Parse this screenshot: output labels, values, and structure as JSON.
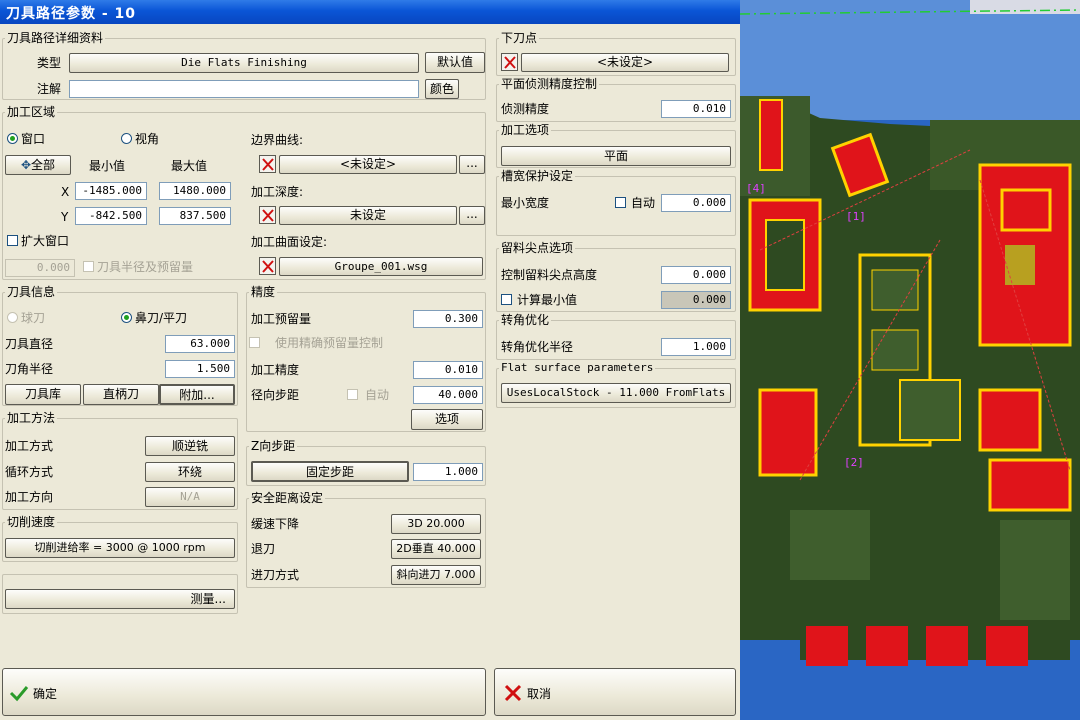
{
  "title": "刀具路径参数 - 10",
  "details": {
    "group_title": "刀具路径详细资料",
    "type_label": "类型",
    "type_value": "Die Flats Finishing",
    "defaults_button": "默认值",
    "note_label": "注解",
    "note_value": "",
    "color_button": "颜色"
  },
  "machining_area": {
    "group_title": "加工区域",
    "window_label": "窗口",
    "view_label": "视角",
    "all_button": "全部",
    "min_header": "最小值",
    "max_header": "最大值",
    "x_label": "X",
    "y_label": "Y",
    "x_min": "-1485.000",
    "x_max": "1480.000",
    "y_min": "-842.500",
    "y_max": "837.500",
    "enlarge_label": "扩大窗口",
    "enlarge_value": "0.000",
    "radius_stock_label": "刀具半径及预留量",
    "boundary_label": "边界曲线:",
    "boundary_value": "<未设定>",
    "depth_label": "加工深度:",
    "depth_value": "未设定",
    "surface_label": "加工曲面设定:",
    "surface_value": "Groupe_001.wsg",
    "ellipsis": "..."
  },
  "tool_info": {
    "group_title": "刀具信息",
    "ball_label": "球刀",
    "nose_label": "鼻刀/平刀",
    "diameter_label": "刀具直径",
    "diameter_value": "63.000",
    "corner_label": "刀角半径",
    "corner_value": "1.500",
    "library_button": "刀具库",
    "holder_button": "直柄刀",
    "extra_button": "附加..."
  },
  "precision": {
    "group_title": "精度",
    "stock_label": "加工预留量",
    "stock_value": "0.300",
    "exact_stock_label": "使用精确预留量控制",
    "tolerance_label": "加工精度",
    "tolerance_value": "0.010",
    "stepover_label": "径向步距",
    "auto_label": "自动",
    "stepover_value": "40.000",
    "options_button": "选项"
  },
  "method": {
    "group_title": "加工方法",
    "mode_label": "加工方式",
    "mode_value": "顺逆铣",
    "loop_label": "循环方式",
    "loop_value": "环绕",
    "dir_label": "加工方向",
    "dir_value": "N/A"
  },
  "zstep": {
    "group_title": "Z向步距",
    "fixed_button": "固定步距",
    "value": "1.000"
  },
  "feed": {
    "group_title": "切削速度",
    "feed_button": "切削进给率 = 3000 @ 1000 rpm"
  },
  "safety": {
    "group_title": "安全距离设定",
    "slowdown_label": "缓速下降",
    "slowdown_value": "3D 20.000",
    "retract_label": "退刀",
    "retract_value": "2D垂直 40.000",
    "entry_label": "进刀方式",
    "entry_value": "斜向进刀 7.000"
  },
  "measure_button": "测量...",
  "down_point": {
    "group_title": "下刀点",
    "value": "<未设定>"
  },
  "flat_detect": {
    "group_title": "平面侦测精度控制",
    "label": "侦测精度",
    "value": "0.010"
  },
  "machining_option": {
    "group_title": "加工选项",
    "value": "平面"
  },
  "slot": {
    "group_title": "槽宽保护设定",
    "min_width_label": "最小宽度",
    "auto_label": "自动",
    "value": "0.000"
  },
  "cusp": {
    "group_title": "留料尖点选项",
    "height_label": "控制留料尖点高度",
    "height_value": "0.000",
    "calc_min_label": "计算最小值",
    "calc_min_value": "0.000"
  },
  "corner_opt": {
    "group_title": "转角优化",
    "label": "转角优化半径",
    "value": "1.000"
  },
  "flat_surface": {
    "group_title": "Flat surface parameters",
    "value": "UsesLocalStock - 11.000 FromFlats"
  },
  "ok_label": "确定",
  "cancel_label": "取消",
  "viewport": {
    "labels": [
      "[4]",
      "[1]",
      "[2]"
    ]
  }
}
